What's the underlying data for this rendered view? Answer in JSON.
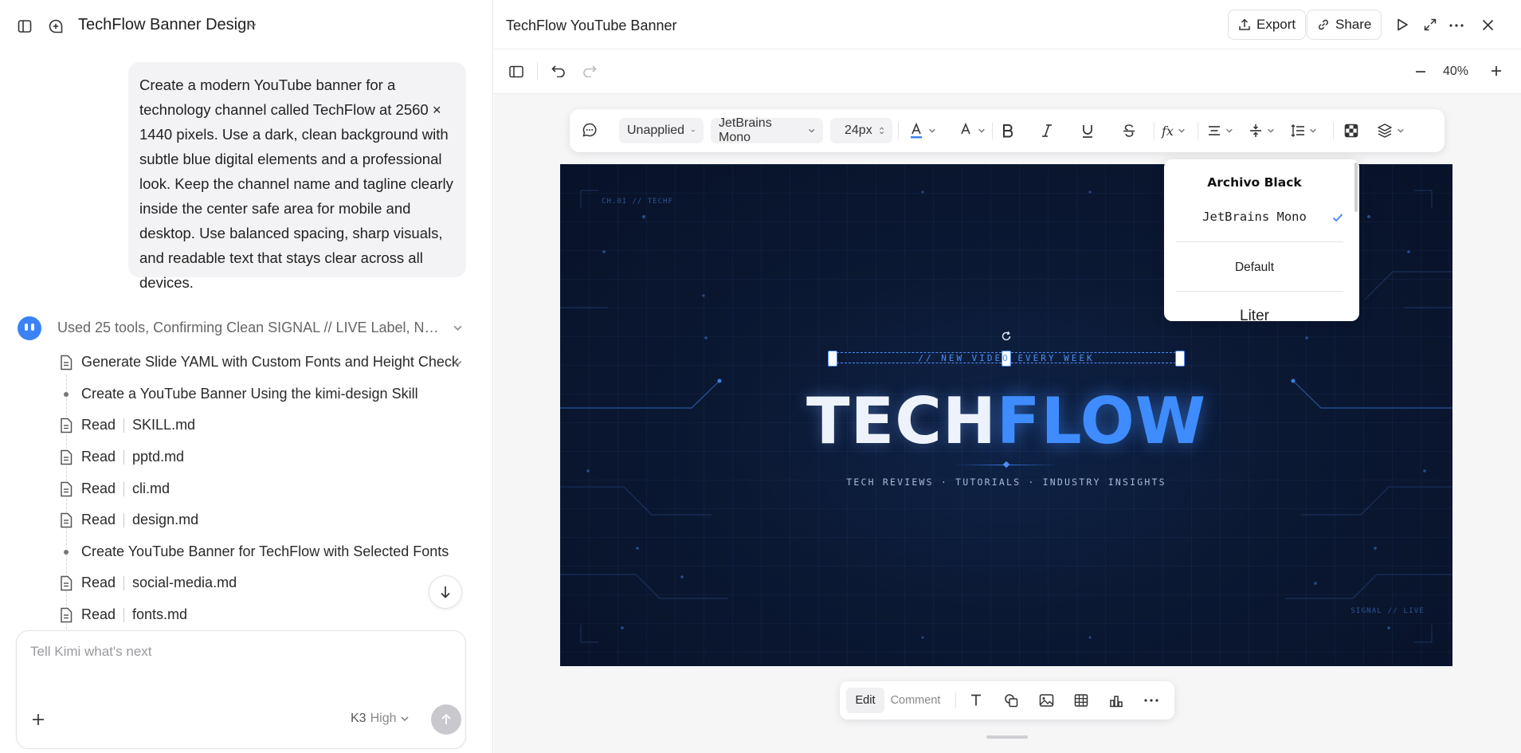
{
  "left": {
    "title": "TechFlow Banner Design",
    "user_message": "Create a modern YouTube banner for a technology channel called TechFlow at 2560 × 1440 pixels. Use a dark, clean background with subtle blue digital elements and a professional look. Keep the channel name and tagline clearly inside the center safe area for mobile and desktop. Use balanced spacing, sharp visuals, and readable text that stays clear across all devices.",
    "tool_summary": "Used 25 tools, Confirming Clean SIGNAL // LIVE Label, No Pa...",
    "steps": [
      {
        "type": "file",
        "label": "Generate Slide YAML with Custom Fonts and Height Check"
      },
      {
        "type": "bullet",
        "label": "Create a YouTube Banner Using the kimi-design Skill"
      },
      {
        "type": "read",
        "action": "Read",
        "file": "SKILL.md"
      },
      {
        "type": "read",
        "action": "Read",
        "file": "pptd.md"
      },
      {
        "type": "read",
        "action": "Read",
        "file": "cli.md"
      },
      {
        "type": "read",
        "action": "Read",
        "file": "design.md"
      },
      {
        "type": "bullet",
        "label": "Create YouTube Banner for TechFlow with Selected Fonts"
      },
      {
        "type": "read",
        "action": "Read",
        "file": "social-media.md"
      },
      {
        "type": "read",
        "action": "Read",
        "file": "fonts.md"
      }
    ],
    "composer": {
      "placeholder": "Tell Kimi what's next",
      "model": "K3",
      "effort": "High"
    }
  },
  "right": {
    "title": "TechFlow YouTube Banner",
    "export_label": "Export",
    "share_label": "Share",
    "zoom": "40%",
    "format": {
      "style": "Unapplied",
      "font": "JetBrains Mono",
      "size": "24px"
    },
    "font_menu": {
      "items": [
        "Archivo Black",
        "JetBrains Mono",
        "Default",
        "Liter"
      ],
      "selected": "JetBrains Mono"
    },
    "banner": {
      "corner_tl": "CH.01 // TECHF",
      "kicker": "// NEW VIDEO EVERY WEEK",
      "name_part1": "TECH",
      "name_part2": "FLOW",
      "tagline": "TECH REVIEWS · TUTORIALS · INDUSTRY INSIGHTS",
      "corner_br": "SIGNAL // LIVE"
    },
    "bottom": {
      "edit": "Edit",
      "comment": "Comment"
    }
  },
  "colors": {
    "accent_blue": "#3b82f6",
    "banner_bg": "#0b1833",
    "flow_blue": "#3f8cff"
  }
}
